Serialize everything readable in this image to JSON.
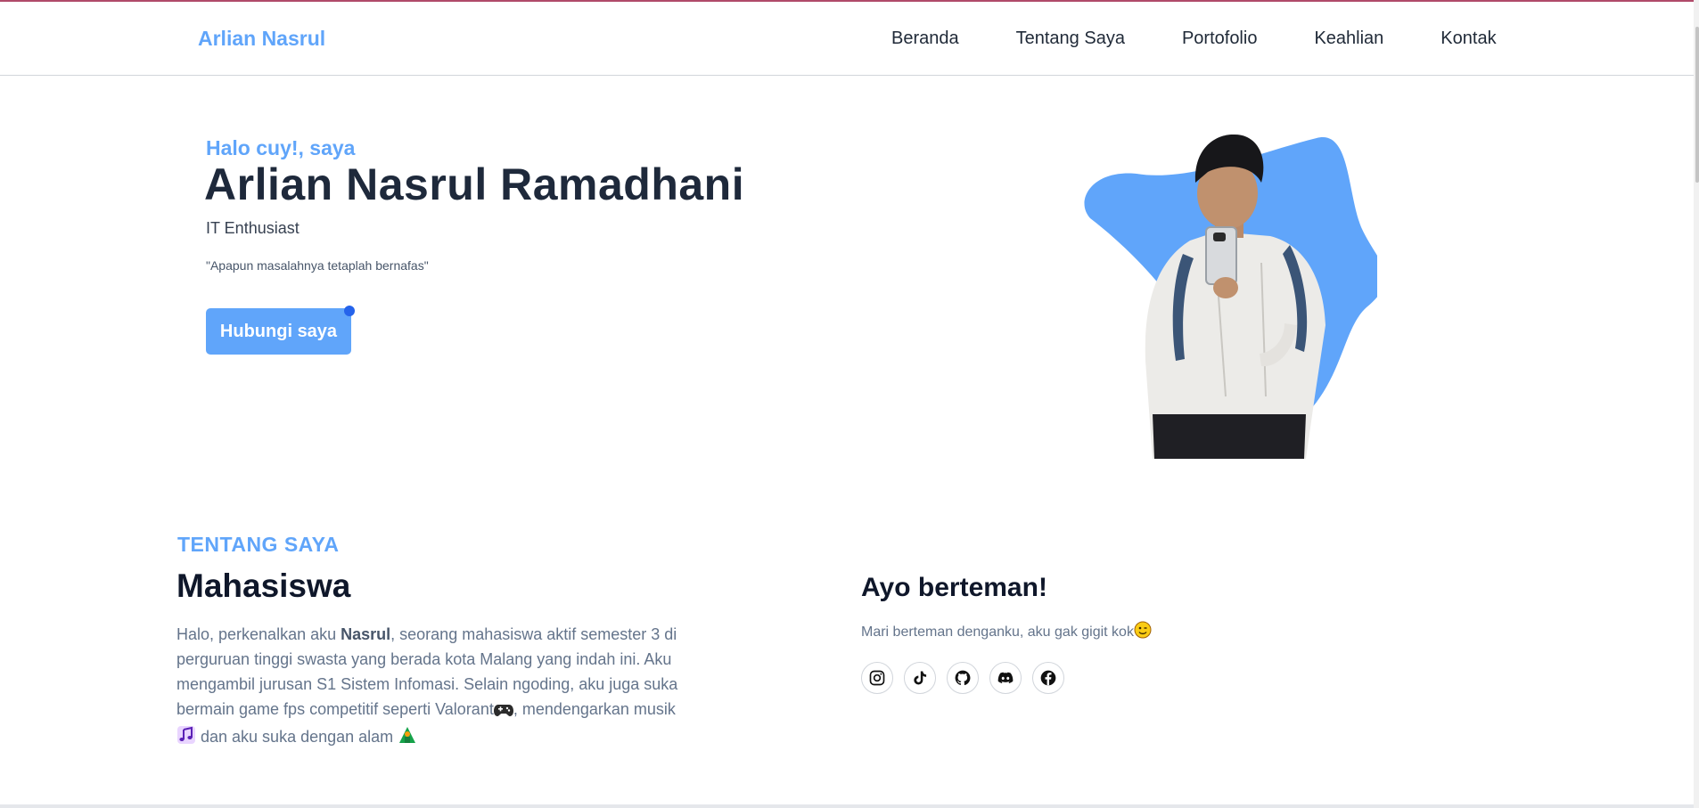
{
  "navbar": {
    "brand": "Arlian Nasrul",
    "items": [
      {
        "label": "Beranda"
      },
      {
        "label": "Tentang Saya"
      },
      {
        "label": "Portofolio"
      },
      {
        "label": "Keahlian"
      },
      {
        "label": "Kontak"
      }
    ]
  },
  "hero": {
    "greeting": "Halo cuy!, saya",
    "name": "Arlian Nasrul Ramadhani",
    "role": "IT Enthusiast",
    "quote": "\"Apapun masalahnya tetaplah bernafas\"",
    "cta_label": "Hubungi saya",
    "blob_color": "#60a5fa"
  },
  "about": {
    "eyebrow": "TENTANG SAYA",
    "title": "Mahasiswa",
    "text_1": "Halo, perkenalkan aku ",
    "name_bold": "Nasrul",
    "text_2": ", seorang mahasiswa aktif semester 3 di perguruan tinggi swasta yang berada kota Malang yang indah ini. Aku mengambil jurusan S1 Sistem Infomasi. Selain ngoding, aku juga suka bermain game fps competitif seperti Valorant",
    "text_3": ", mendengarkan musik",
    "text_4": " dan aku suka dengan alam "
  },
  "friends": {
    "title": "Ayo berteman!",
    "text": "Mari berteman denganku, aku gak gigit kok",
    "socials": [
      "instagram-icon",
      "tiktok-icon",
      "github-icon",
      "discord-icon",
      "facebook-icon"
    ]
  },
  "colors": {
    "accent": "#60a5fa",
    "heading": "#1e293b",
    "muted": "#64748b"
  }
}
